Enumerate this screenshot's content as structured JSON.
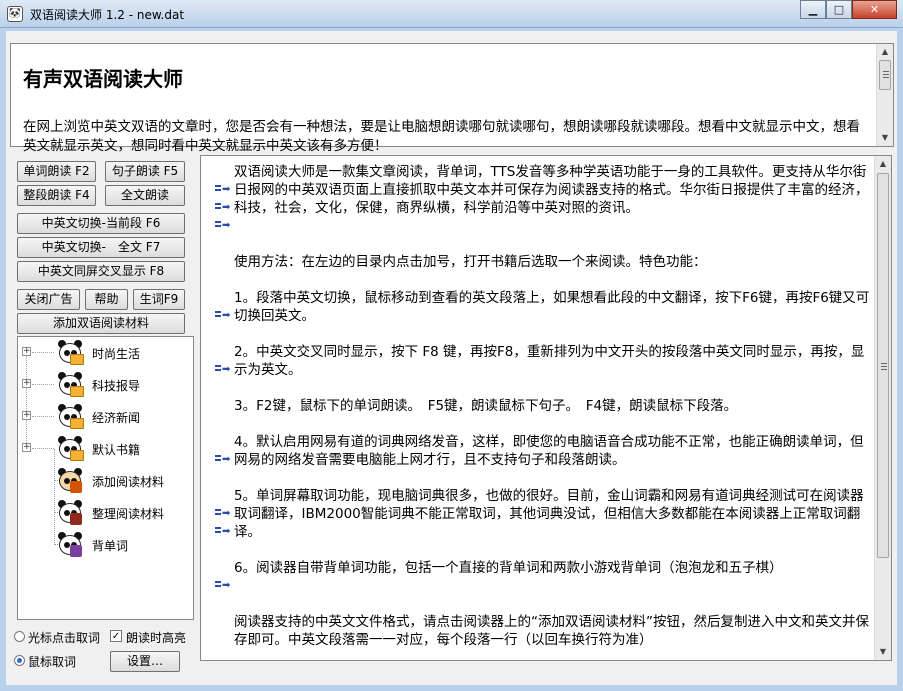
{
  "window": {
    "title": "双语阅读大师 1.2 - new.dat",
    "icon": "panda-app-icon",
    "controls": [
      "minimize",
      "maximize",
      "close"
    ]
  },
  "header": {
    "title": "有声双语阅读大师",
    "description": "在网上浏览中英文双语的文章时，您是否会有一种想法，要是让电脑想朗读哪句就读哪句，想朗读哪段就读哪段。想看中文就显示中文，想看英文就显示英文，想同时看中英文就显示中英文该有多方便！"
  },
  "buttons": {
    "word_read": "单词朗读 F2",
    "sentence_read": "句子朗读 F5",
    "para_read": "整段朗读 F4",
    "full_read": "全文朗读",
    "switch_para": "中英文切换-当前段 F6",
    "switch_full": "中英文切换-　全文 F7",
    "interleave": "中英文同屏交叉显示 F8",
    "close_ad": "关闭广告",
    "help": "帮助",
    "vocab": "生词F9",
    "add_material": "添加双语阅读材料",
    "settings": "设置…"
  },
  "tree": {
    "items": [
      {
        "label": "时尚生活",
        "icon": "panda-folder-icon",
        "expandable": true
      },
      {
        "label": "科技报导",
        "icon": "panda-folder-icon",
        "expandable": true
      },
      {
        "label": "经济新闻",
        "icon": "panda-folder-icon",
        "expandable": true
      },
      {
        "label": "默认书籍",
        "icon": "panda-folder-icon",
        "expandable": true
      },
      {
        "label": "添加阅读材料",
        "icon": "panda-add-icon",
        "expandable": false
      },
      {
        "label": "整理阅读材料",
        "icon": "panda-organize-icon",
        "expandable": false
      },
      {
        "label": "背单词",
        "icon": "panda-vocab-icon",
        "expandable": false
      }
    ]
  },
  "options": {
    "cursor_click": "光标点击取词",
    "highlight": "朗读时高亮",
    "mouse_pick": "鼠标取词",
    "cursor_click_selected": false,
    "mouse_pick_selected": true,
    "highlight_checked": true
  },
  "content": {
    "paragraphs": [
      {
        "text": "双语阅读大师是一款集文章阅读，背单词，TTS发音等多种学英语功能于一身的工具软件。更支持从华尔街日报网的中英双语页面上直接抓取中英文本并可保存为阅读器支持的格式。华尔街日报提供了丰富的经济，科技，社会，文化，保健，商界纵横，科学前沿等中英对照的资讯。",
        "marker_lines": [
          1,
          2,
          3
        ]
      },
      {
        "text": "使用方法：在左边的目录内点击加号，打开书籍后选取一个来阅读。特色功能：",
        "marker_lines": []
      },
      {
        "text": "1。段落中英文切换，鼠标移动到查看的英文段落上，如果想看此段的中文翻译，按下F6键，再按F6键又可切换回英文。",
        "marker_lines": [
          1
        ]
      },
      {
        "text": "2。中英文交叉同时显示，按下 F8 键，再按F8，重新排列为中文开头的按段落中英文同时显示，再按，显示为英文。",
        "marker_lines": [
          1
        ]
      },
      {
        "text": "3。F2键，鼠标下的单词朗读。　F5键，朗读鼠标下句子。　F4键，朗读鼠标下段落。",
        "marker_lines": []
      },
      {
        "text": "4。默认启用网易有道的词典网络发音，这样，即使您的电脑语音合成功能不正常，也能正确朗读单词，但网易的网络发音需要电脑能上网才行，且不支持句子和段落朗读。",
        "marker_lines": [
          1
        ]
      },
      {
        "text": "5。单词屏幕取词功能，现电脑词典很多，也做的很好。目前，金山词霸和网易有道词典经测试可在阅读器取词翻译，IBM2000智能词典不能正常取词，其他词典没试，但相信大多数都能在本阅读器上正常取词翻译。",
        "marker_lines": [
          1,
          2
        ]
      },
      {
        "text": "6。阅读器自带背单词功能，包括一个直接的背单词和两款小游戏背单词（泡泡龙和五子棋）",
        "marker_lines": [
          1
        ]
      },
      {
        "text": "阅读器支持的中英文文件格式，请点击阅读器上的“添加双语阅读材料”按钮，然后复制进入中文和英文并保存即可。中英文段落需一一对应，每个段落一行（以回车换行符为准）",
        "marker_lines": []
      }
    ]
  }
}
